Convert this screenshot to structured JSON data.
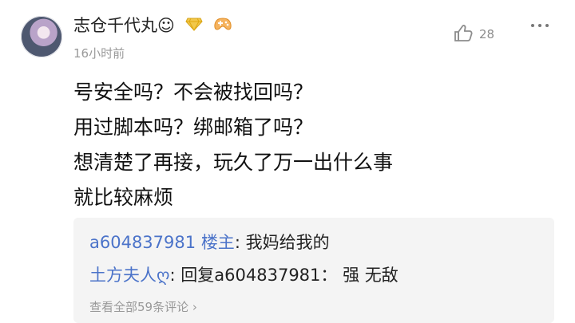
{
  "post": {
    "username": "志仓千代丸",
    "username_suffix": "☺",
    "time": "16小时前",
    "likes": "28",
    "lines": [
      "号安全吗？不会被找回吗？",
      "用过脚本吗？绑邮箱了吗？",
      "想清楚了再接，玩久了万一出什么事",
      "就比较麻烦"
    ]
  },
  "replies": [
    {
      "author": "a604837981",
      "tag": "楼主",
      "separator": ":",
      "text": "我妈给我的"
    },
    {
      "author": "土方夫人ღ",
      "separator": ":",
      "reply_prefix": "回复",
      "reply_to": "a604837981",
      "reply_sep": "：",
      "text": "强 无敌"
    }
  ],
  "view_all": "查看全部59条评论",
  "colors": {
    "accent": "#4b73c9",
    "muted": "#9a9a9a"
  },
  "icons": {
    "badge1": "diamond-badge-icon",
    "badge2": "game-controller-badge-icon",
    "like": "thumbs-up-icon",
    "more": "more-dots-icon"
  }
}
